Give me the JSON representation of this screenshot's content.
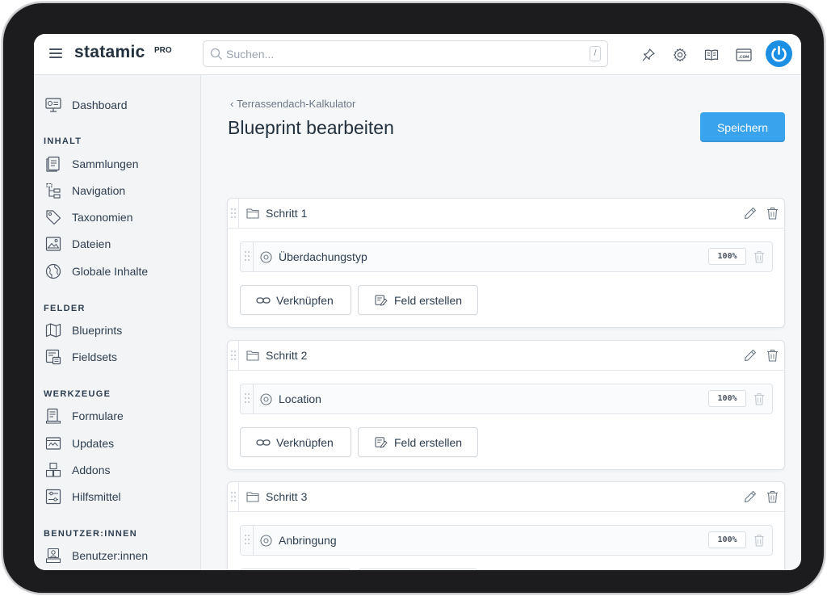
{
  "topbar": {
    "logo": "statamic",
    "logo_badge": "PRO",
    "search_placeholder": "Suchen...",
    "search_shortcut": "/"
  },
  "sidebar": {
    "dashboard": "Dashboard",
    "sections": [
      {
        "title": "INHALT",
        "items": [
          "Sammlungen",
          "Navigation",
          "Taxonomien",
          "Dateien",
          "Globale Inhalte"
        ]
      },
      {
        "title": "FELDER",
        "items": [
          "Blueprints",
          "Fieldsets"
        ]
      },
      {
        "title": "WERKZEUGE",
        "items": [
          "Formulare",
          "Updates",
          "Addons",
          "Hilfsmittel"
        ]
      },
      {
        "title": "BENUTZER:INNEN",
        "items": [
          "Benutzer:innen"
        ]
      }
    ]
  },
  "main": {
    "breadcrumb": "Terrassendach-Kalkulator",
    "title": "Blueprint bearbeiten",
    "save_label": "Speichern",
    "sections": [
      {
        "title": "Schritt 1",
        "field": "Überdachungstyp",
        "width": "100%"
      },
      {
        "title": "Schritt 2",
        "field": "Location",
        "width": "100%"
      },
      {
        "title": "Schritt 3",
        "field": "Anbringung",
        "width": "100%"
      }
    ],
    "link_label": "Verknüpfen",
    "create_label": "Feld erstellen"
  },
  "colors": {
    "accent": "#3aa3ed",
    "power": "#1a8fe3",
    "text": "#2c3e50"
  }
}
